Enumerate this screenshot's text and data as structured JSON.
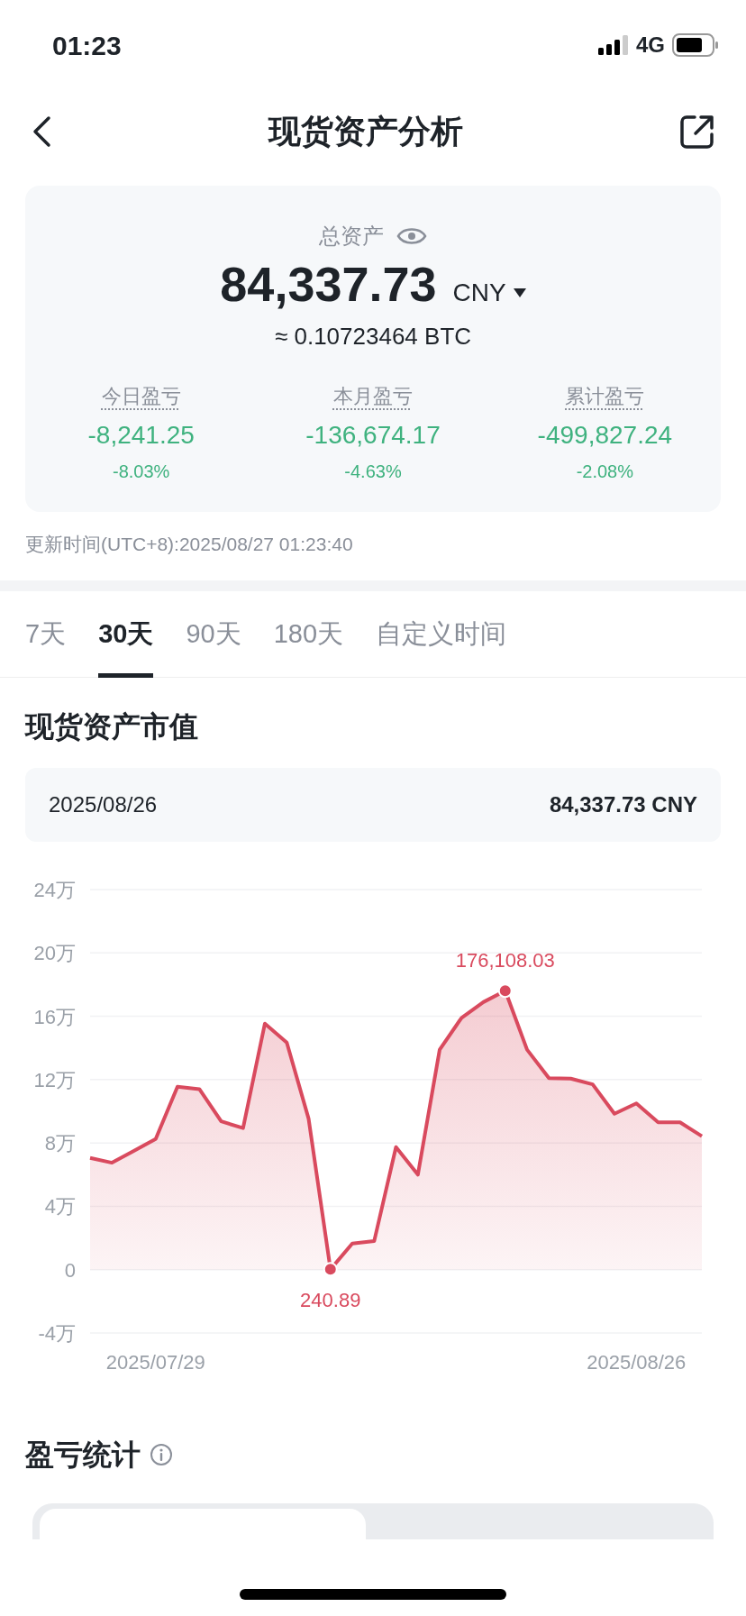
{
  "status_bar": {
    "time": "01:23",
    "network": "4G"
  },
  "header": {
    "title": "现货资产分析"
  },
  "summary": {
    "label": "总资产",
    "total": "84,337.73",
    "currency": "CNY",
    "btc_equivalent": "≈ 0.10723464 BTC",
    "stats": [
      {
        "label": "今日盈亏",
        "value": "-8,241.25",
        "percent": "-8.03%"
      },
      {
        "label": "本月盈亏",
        "value": "-136,674.17",
        "percent": "-4.63%"
      },
      {
        "label": "累计盈亏",
        "value": "-499,827.24",
        "percent": "-2.08%"
      }
    ]
  },
  "update_time": "更新时间(UTC+8):2025/08/27 01:23:40",
  "tabs": [
    {
      "label": "7天",
      "selected": false
    },
    {
      "label": "30天",
      "selected": true
    },
    {
      "label": "90天",
      "selected": false
    },
    {
      "label": "180天",
      "selected": false
    },
    {
      "label": "自定义时间",
      "selected": false
    }
  ],
  "market_value": {
    "title": "现货资产市值",
    "date": "2025/08/26",
    "value": "84,337.73 CNY",
    "chart_data": {
      "type": "area",
      "categories": [
        null,
        null,
        null,
        "2025/07/29",
        null,
        null,
        null,
        null,
        null,
        null,
        null,
        null,
        null,
        null,
        null,
        null,
        null,
        null,
        null,
        null,
        null,
        null,
        null,
        null,
        null,
        "2025/08/26",
        null,
        null,
        null
      ],
      "series": [
        {
          "color": "#d94a5e",
          "values": [
            7.05,
            6.75,
            7.5,
            8.25,
            11.55,
            11.4,
            9.36,
            8.94,
            15.54,
            14.34,
            9.54,
            0.02,
            1.65,
            1.8,
            7.74,
            6.0,
            13.89,
            15.9,
            16.89,
            17.61,
            13.89,
            12.09,
            12.06,
            11.7,
            9.84,
            10.5,
            9.3,
            9.3,
            8.43
          ]
        }
      ],
      "ylim": [
        -4,
        24
      ],
      "yticks": [
        {
          "value": 24,
          "label": "24万"
        },
        {
          "value": 20,
          "label": "20万"
        },
        {
          "value": 16,
          "label": "16万"
        },
        {
          "value": 12,
          "label": "12万"
        },
        {
          "value": 8,
          "label": "8万"
        },
        {
          "value": 4,
          "label": "4万"
        },
        {
          "value": 0,
          "label": "0"
        },
        {
          "value": -4,
          "label": "-4万"
        }
      ],
      "grid": true,
      "annotations": [
        {
          "y": 0.02,
          "text": "240.89"
        },
        {
          "y": 17.61,
          "text": "176,108.03"
        }
      ]
    }
  },
  "pnl_stats": {
    "title": "盈亏统计"
  }
}
